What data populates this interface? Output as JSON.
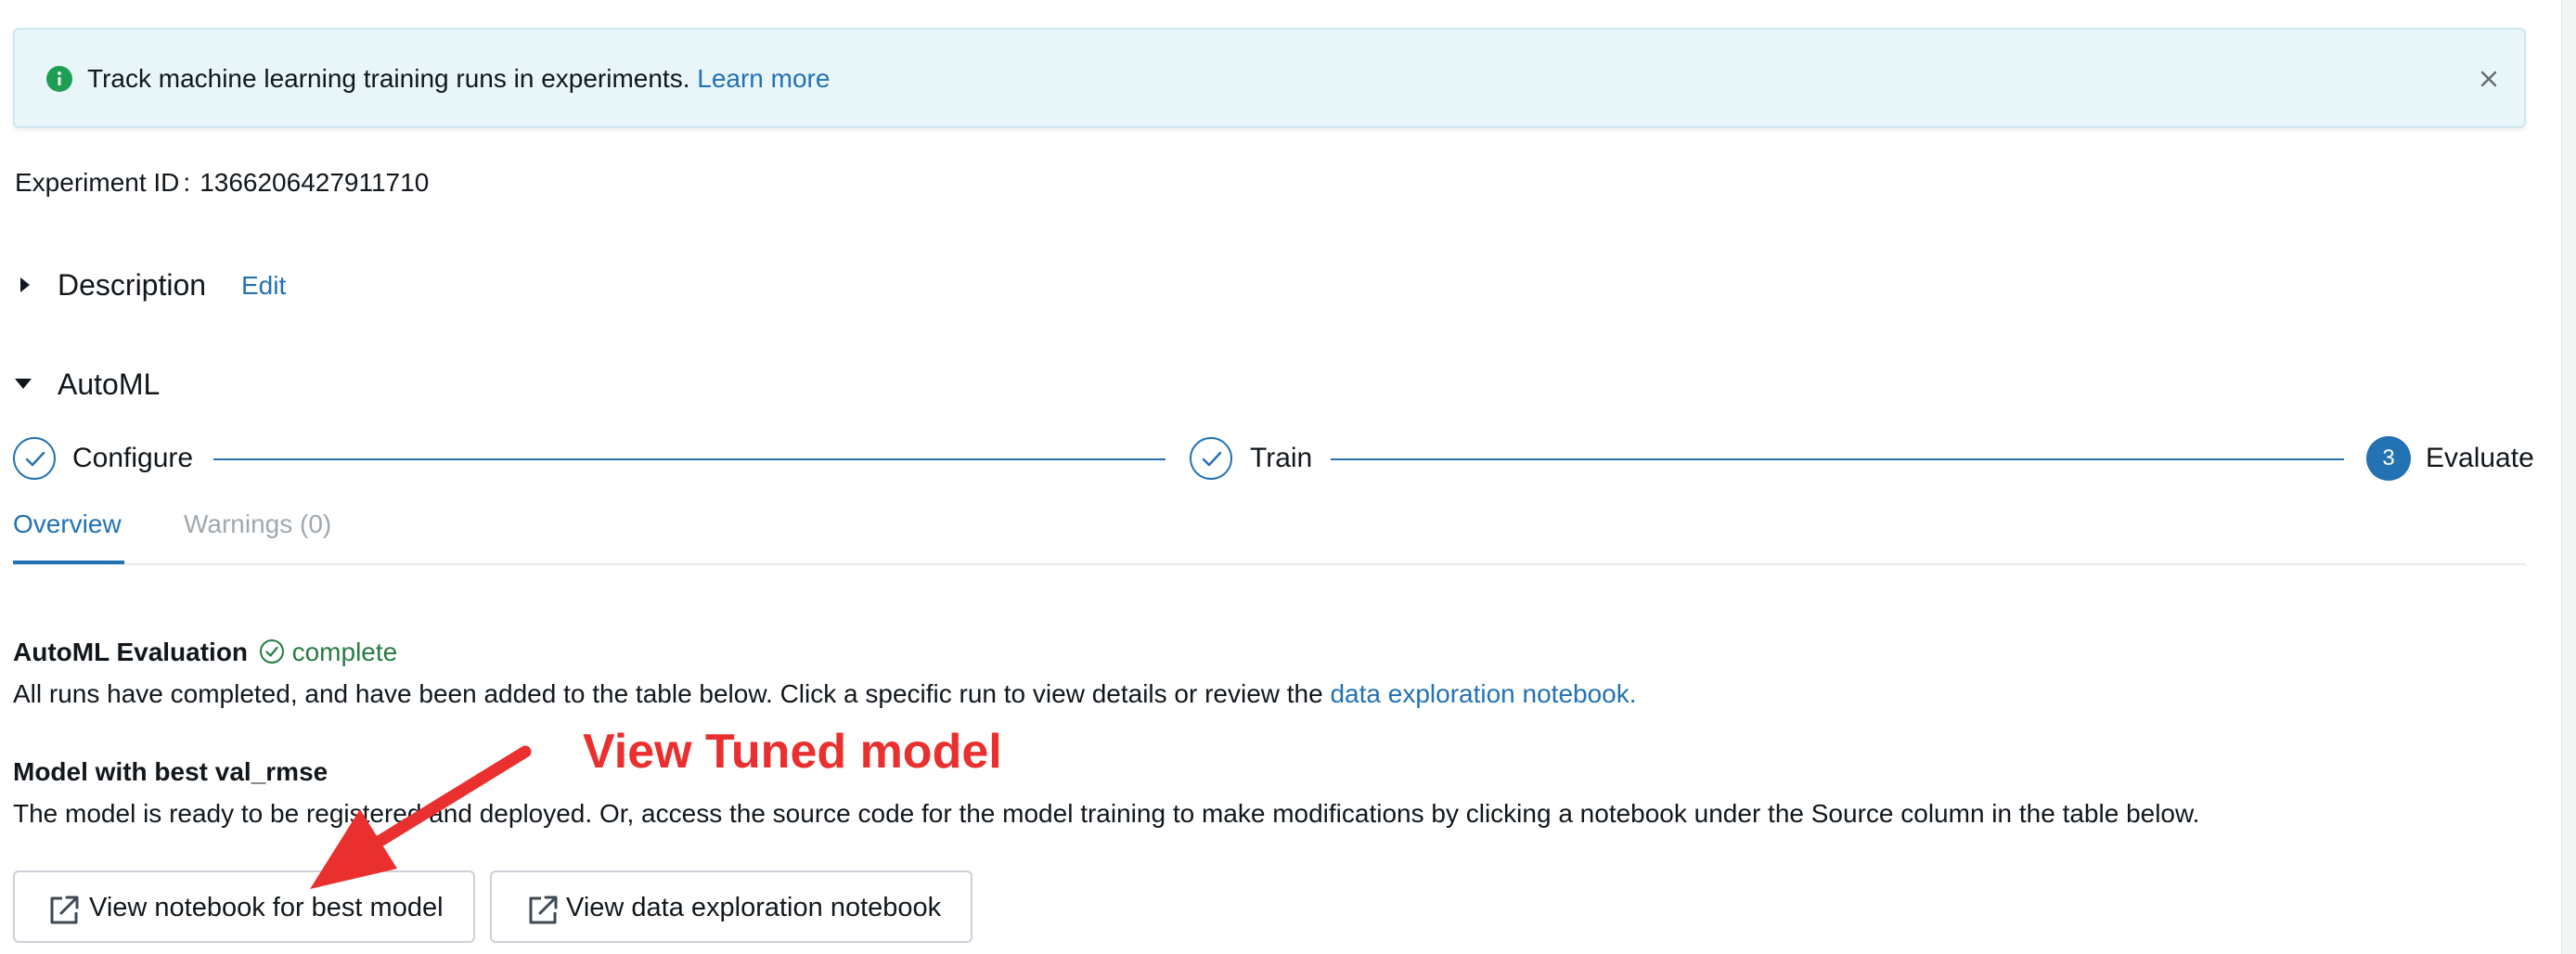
{
  "banner": {
    "message": "Track machine learning training runs in experiments.",
    "link_text": "Learn more",
    "icon": "info-icon",
    "close_icon": "close-icon"
  },
  "experiment": {
    "id_label": "Experiment ID",
    "id_separator": ":",
    "id_value": "1366206427911710"
  },
  "description": {
    "title": "Description",
    "edit_label": "Edit"
  },
  "automl": {
    "title": "AutoML",
    "steps": [
      {
        "label": "Configure",
        "state": "done"
      },
      {
        "label": "Train",
        "state": "done"
      },
      {
        "label": "Evaluate",
        "state": "active",
        "number": "3"
      }
    ],
    "tabs": [
      {
        "label": "Overview",
        "active": true
      },
      {
        "label": "Warnings (0)",
        "active": false
      }
    ]
  },
  "evaluation": {
    "title": "AutoML Evaluation",
    "status": "complete",
    "description": "All runs have completed, and have been added to the table below. Click a specific run to view details or review the",
    "link_text": "data exploration notebook."
  },
  "best_model": {
    "title": "Model with best val_rmse",
    "description": "The model is ready to be registered and deployed. Or, access the source code for the model training to make modifications by clicking a notebook under the Source column in the table below."
  },
  "buttons": {
    "best_model_notebook": "View notebook for best model",
    "data_exploration_notebook": "View data exploration notebook"
  },
  "annotation": {
    "label": "View Tuned model"
  },
  "colors": {
    "accent": "#2272b4",
    "banner_bg": "#e8f6fa",
    "success": "#277c43",
    "annotation": "#e9302e",
    "info_icon": "#1d9e52"
  }
}
